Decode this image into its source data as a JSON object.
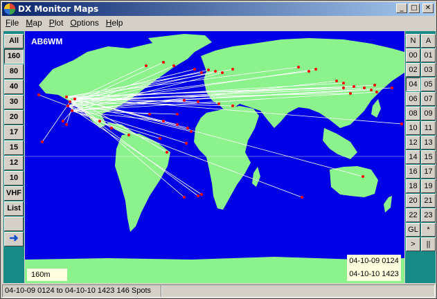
{
  "window": {
    "title": "DX Monitor Maps"
  },
  "menu": [
    {
      "label": "File"
    },
    {
      "label": "Map"
    },
    {
      "label": "Plot"
    },
    {
      "label": "Options"
    },
    {
      "label": "Help"
    }
  ],
  "bands": [
    {
      "label": "All"
    },
    {
      "label": "160"
    },
    {
      "label": "80"
    },
    {
      "label": "40"
    },
    {
      "label": "30"
    },
    {
      "label": "20"
    },
    {
      "label": "17"
    },
    {
      "label": "15"
    },
    {
      "label": "12"
    },
    {
      "label": "10"
    },
    {
      "label": "VHF"
    },
    {
      "label": "List"
    }
  ],
  "active_band": "160",
  "hours": [
    [
      "N",
      "A"
    ],
    [
      "00",
      "01"
    ],
    [
      "02",
      "03"
    ],
    [
      "04",
      "05"
    ],
    [
      "06",
      "07"
    ],
    [
      "08",
      "09"
    ],
    [
      "10",
      "11"
    ],
    [
      "12",
      "13"
    ],
    [
      "14",
      "15"
    ],
    [
      "16",
      "17"
    ],
    [
      "18",
      "19"
    ],
    [
      "20",
      "21"
    ],
    [
      "22",
      "23"
    ],
    [
      "GL",
      "*"
    ],
    [
      ">",
      "||"
    ]
  ],
  "map": {
    "callsign": "AB6WM",
    "band_label": "160m",
    "time_from": "04-10-09 0124",
    "time_to": "04-10-10 1423",
    "colors": {
      "ocean": "#0000e6",
      "land": "#8cf28c",
      "spot": "#ff0000",
      "path": "#ffffff"
    }
  },
  "status": {
    "text": "04-10-09 0124 to 04-10-10 1423 146 Spots"
  }
}
